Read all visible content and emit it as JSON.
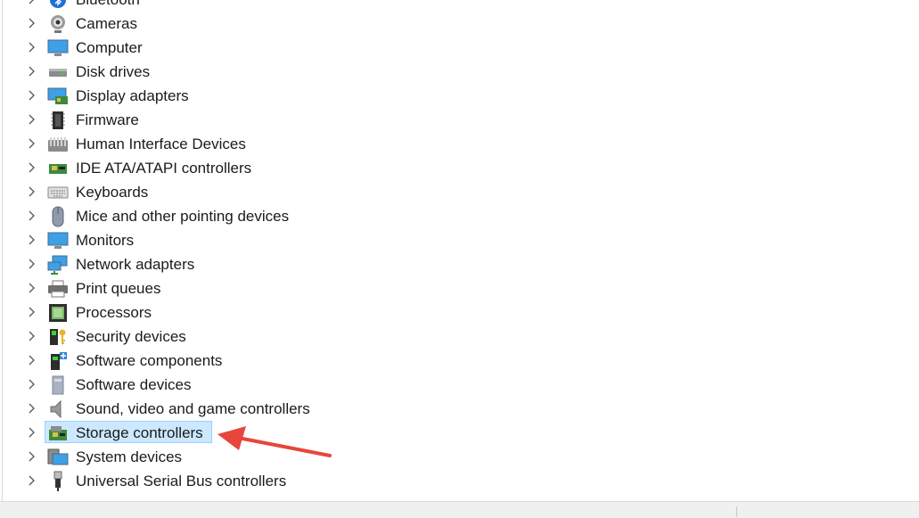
{
  "tree": {
    "items": [
      {
        "label": "Bluetooth",
        "icon": "bluetooth-icon"
      },
      {
        "label": "Cameras",
        "icon": "camera-icon"
      },
      {
        "label": "Computer",
        "icon": "computer-icon"
      },
      {
        "label": "Disk drives",
        "icon": "disk-drive-icon"
      },
      {
        "label": "Display adapters",
        "icon": "display-adapter-icon"
      },
      {
        "label": "Firmware",
        "icon": "firmware-icon"
      },
      {
        "label": "Human Interface Devices",
        "icon": "hid-icon"
      },
      {
        "label": "IDE ATA/ATAPI controllers",
        "icon": "ide-controller-icon"
      },
      {
        "label": "Keyboards",
        "icon": "keyboard-icon"
      },
      {
        "label": "Mice and other pointing devices",
        "icon": "mouse-icon"
      },
      {
        "label": "Monitors",
        "icon": "monitor-icon"
      },
      {
        "label": "Network adapters",
        "icon": "network-adapter-icon"
      },
      {
        "label": "Print queues",
        "icon": "printer-icon"
      },
      {
        "label": "Processors",
        "icon": "processor-icon"
      },
      {
        "label": "Security devices",
        "icon": "security-device-icon"
      },
      {
        "label": "Software components",
        "icon": "software-component-icon"
      },
      {
        "label": "Software devices",
        "icon": "software-device-icon"
      },
      {
        "label": "Sound, video and game controllers",
        "icon": "speaker-icon"
      },
      {
        "label": "Storage controllers",
        "icon": "storage-controller-icon"
      },
      {
        "label": "System devices",
        "icon": "system-device-icon"
      },
      {
        "label": "Universal Serial Bus controllers",
        "icon": "usb-icon"
      }
    ],
    "selected_index": 18
  },
  "colors": {
    "selection_fill": "#cce8ff",
    "selection_border": "#99d1ff",
    "annotation_arrow": "#e8453c"
  }
}
